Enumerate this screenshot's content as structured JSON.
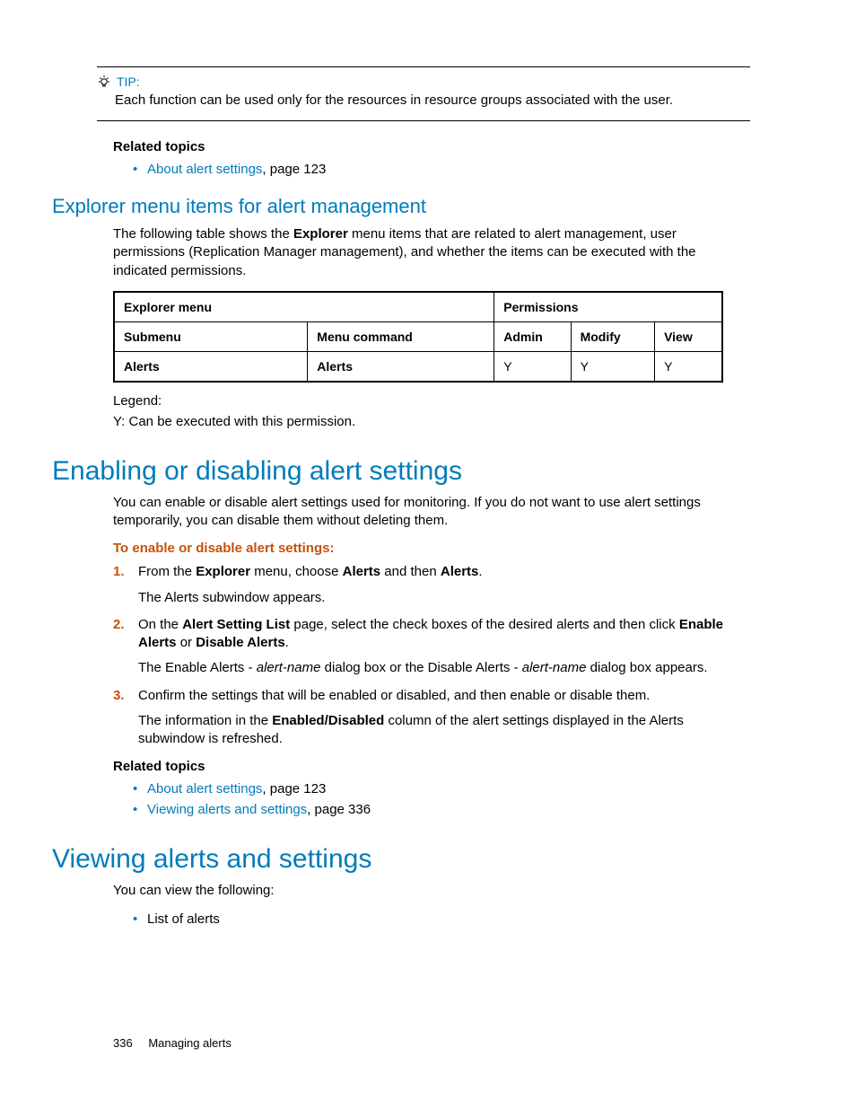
{
  "tip": {
    "label": "TIP:",
    "body": "Each function can be used only for the resources in resource groups associated with the user."
  },
  "related1": {
    "heading": "Related topics",
    "items": [
      {
        "link": "About alert settings",
        "suffix": ", page 123"
      }
    ]
  },
  "section_explorer": {
    "title": "Explorer menu items for alert management",
    "intro_pre": "The following table shows the ",
    "intro_bold": "Explorer",
    "intro_post": " menu items that are related to alert management, user permissions (Replication Manager management), and whether the items can be executed with the indicated permissions."
  },
  "table": {
    "h_explorer": "Explorer menu",
    "h_perm": "Permissions",
    "h_sub": "Submenu",
    "h_cmd": "Menu command",
    "h_admin": "Admin",
    "h_modify": "Modify",
    "h_view": "View",
    "row": {
      "sub": "Alerts",
      "cmd": "Alerts",
      "admin": "Y",
      "modify": "Y",
      "view": "Y"
    }
  },
  "legend": {
    "l1": "Legend:",
    "l2": "Y: Can be executed with this permission."
  },
  "section_enable": {
    "title": "Enabling or disabling alert settings",
    "intro": "You can enable or disable alert settings used for monitoring. If you do not want to use alert settings temporarily, you can disable them without deleting them.",
    "proc_heading": "To enable or disable alert settings:",
    "steps": {
      "s1": {
        "pre": "From the ",
        "b1": "Explorer",
        "mid1": " menu, choose ",
        "b2": "Alerts",
        "mid2": " and then ",
        "b3": "Alerts",
        "post": ".",
        "after": "The Alerts subwindow appears."
      },
      "s2": {
        "pre": "On the ",
        "b1": "Alert Setting List",
        "mid1": " page, select the check boxes of the desired alerts and then click ",
        "b2": "Enable Alerts",
        "mid2": " or ",
        "b3": "Disable Alerts",
        "post": ".",
        "after_pre": "The Enable Alerts - ",
        "after_i1": "alert-name",
        "after_mid": " dialog box or the Disable Alerts - ",
        "after_i2": "alert-name",
        "after_post": " dialog box appears."
      },
      "s3": {
        "main": "Confirm the settings that will be enabled or disabled, and then enable or disable them.",
        "after_pre": "The information in the ",
        "after_b": "Enabled/Disabled",
        "after_post": " column of the alert settings displayed in the Alerts subwindow is refreshed."
      }
    }
  },
  "related2": {
    "heading": "Related topics",
    "items": [
      {
        "link": "About alert settings",
        "suffix": ", page 123"
      },
      {
        "link": "Viewing alerts and settings",
        "suffix": ", page 336"
      }
    ]
  },
  "section_view": {
    "title": "Viewing alerts and settings",
    "intro": "You can view the following:",
    "items": [
      {
        "text": "List of alerts"
      }
    ]
  },
  "footer": {
    "page": "336",
    "chapter": "Managing alerts"
  }
}
